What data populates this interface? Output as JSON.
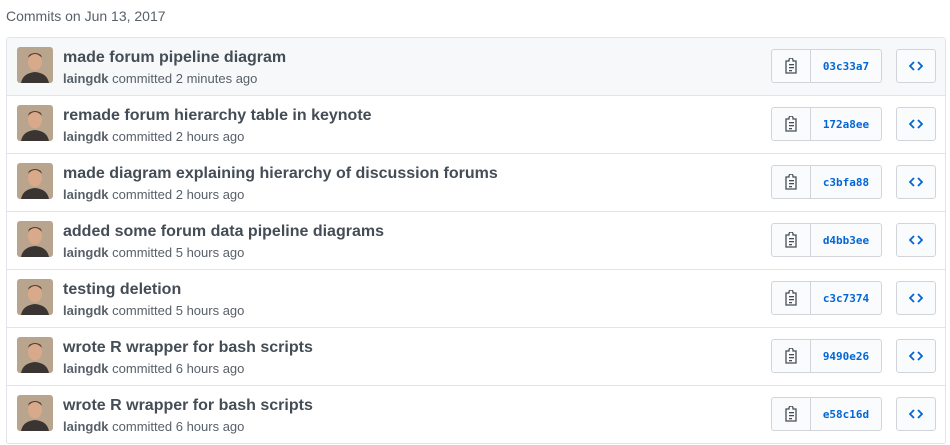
{
  "day_header": "Commits on Jun 13, 2017",
  "icons": {
    "copy": "clippy-icon",
    "browse": "code-icon"
  },
  "commits": [
    {
      "title": "made forum pipeline diagram",
      "author": "laingdk",
      "action": "committed",
      "time": "2 minutes ago",
      "sha": "03c33a7"
    },
    {
      "title": "remade forum hierarchy table in keynote",
      "author": "laingdk",
      "action": "committed",
      "time": "2 hours ago",
      "sha": "172a8ee"
    },
    {
      "title": "made diagram explaining hierarchy of discussion forums",
      "author": "laingdk",
      "action": "committed",
      "time": "2 hours ago",
      "sha": "c3bfa88"
    },
    {
      "title": "added some forum data pipeline diagrams",
      "author": "laingdk",
      "action": "committed",
      "time": "5 hours ago",
      "sha": "d4bb3ee"
    },
    {
      "title": "testing deletion",
      "author": "laingdk",
      "action": "committed",
      "time": "5 hours ago",
      "sha": "c3c7374"
    },
    {
      "title": "wrote R wrapper for bash scripts",
      "author": "laingdk",
      "action": "committed",
      "time": "6 hours ago",
      "sha": "9490e26"
    },
    {
      "title": "wrote R wrapper for bash scripts",
      "author": "laingdk",
      "action": "committed",
      "time": "6 hours ago",
      "sha": "e58c16d"
    }
  ]
}
